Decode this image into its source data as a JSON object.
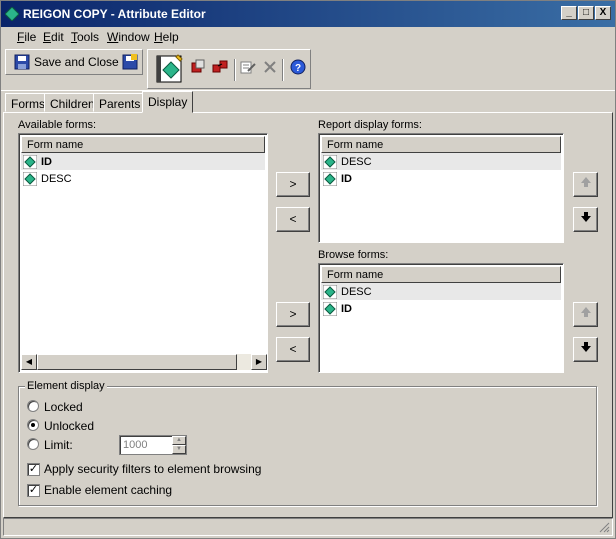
{
  "window": {
    "title": "REIGON COPY - Attribute Editor"
  },
  "window_buttons": {
    "minimize": "_",
    "maximize": "□",
    "close": "X"
  },
  "menu": [
    {
      "label": "File",
      "u": "F",
      "rest": "ile"
    },
    {
      "label": "Edit",
      "u": "E",
      "rest": "dit"
    },
    {
      "label": "Tools",
      "u": "T",
      "rest": "ools"
    },
    {
      "label": "Window",
      "u": "W",
      "rest": "indow"
    },
    {
      "label": "Help",
      "u": "H",
      "rest": "elp"
    }
  ],
  "toolbar": {
    "save_close_label": "Save and Close"
  },
  "tabs": [
    "Forms",
    "Children",
    "Parents",
    "Display"
  ],
  "active_tab": "Display",
  "available_forms": {
    "label": "Available forms:",
    "column": "Form name",
    "rows": [
      "ID",
      "DESC"
    ]
  },
  "report_display_forms": {
    "label": "Report display forms:",
    "column": "Form name",
    "rows": [
      "DESC",
      "ID"
    ]
  },
  "browse_forms": {
    "label": "Browse forms:",
    "column": "Form name",
    "rows": [
      "DESC",
      "ID"
    ]
  },
  "buttons": {
    "add": ">",
    "remove": "<"
  },
  "element_display": {
    "title": "Element display",
    "locked": "Locked",
    "unlocked": "Unlocked",
    "limit": "Limit:",
    "limit_value": "1000",
    "selected": "unlocked",
    "apply_security": "Apply security filters to element browsing",
    "enable_caching": "Enable element caching",
    "apply_security_checked": true,
    "enable_caching_checked": true
  },
  "colors": {
    "title_start": "#0a246a",
    "title_end": "#3a6ea5",
    "attr_icon": "#2bb58a"
  }
}
